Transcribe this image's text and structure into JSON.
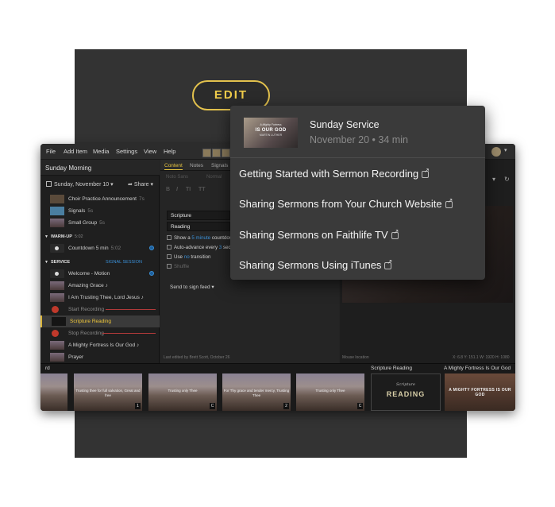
{
  "badge": {
    "label": "EDIT"
  },
  "popover": {
    "thumb": {
      "line1": "A Mighty Fortress",
      "line2": "IS OUR GOD",
      "line3": "MARTIN LUTHER"
    },
    "title": "Sunday Service",
    "date": "November 20",
    "separator": "•",
    "duration": "34 min",
    "links": [
      {
        "label": "Getting Started with Sermon Recording"
      },
      {
        "label": "Sharing Sermons from Your Church Website"
      },
      {
        "label": "Sharing Sermons on Faithlife TV"
      },
      {
        "label": "Sharing Sermons Using iTunes"
      }
    ]
  },
  "menu": [
    "File",
    "Add Item",
    "Media",
    "Settings",
    "View",
    "Help"
  ],
  "left_panel": {
    "service_title": "Sunday Morning",
    "date": "Sunday, November 10",
    "date_caret": "▾",
    "share": "Share",
    "items_top": [
      {
        "label": "Choir Practice Announcement",
        "meta": "7s"
      },
      {
        "label": "Signals",
        "meta": "5s"
      },
      {
        "label": "Small Group",
        "meta": "5s"
      }
    ],
    "sections": [
      {
        "name": "WARM-UP",
        "time": "5:02"
      },
      {
        "name": "SERVICE",
        "time": "",
        "hint": "SIGNAL SESSION"
      }
    ],
    "countdown": {
      "label": "Countdown 5 min",
      "meta": "5:02"
    },
    "service_items": [
      {
        "label": "Welcome - Motion"
      },
      {
        "label": "Amazing Grace",
        "suffix": "♪"
      },
      {
        "label": "I Am Trusting Thee, Lord Jesus",
        "suffix": "♪"
      },
      {
        "label": "Start Recording"
      },
      {
        "label": "Scripture Reading"
      },
      {
        "label": "Stop Recording"
      },
      {
        "label": "A Mighty Fortress Is Our God",
        "suffix": "♪"
      },
      {
        "label": "Prayer"
      }
    ]
  },
  "editor": {
    "tabs": [
      "Content",
      "Notes",
      "Signals"
    ],
    "tool_labels": {
      "font": "Noto Sans",
      "weight": "Normal"
    },
    "format_buttons": [
      "B",
      "I",
      "TI",
      "TT"
    ],
    "type_field": "Scripture",
    "mode_field": "Reading",
    "options": [
      {
        "pre": "Show a",
        "link": "5 minute",
        "post": "countdown"
      },
      {
        "pre": "Auto-advance every",
        "link": "3",
        "post": "sec"
      },
      {
        "pre": "Use",
        "link": "no",
        "post": "transition"
      },
      {
        "pre": "Shuffle",
        "link": "",
        "post": ""
      }
    ],
    "send_feed": "Send to sign feed",
    "edited_by": "Last edited by Brett Scott, October 26"
  },
  "preview": {
    "mouse_label": "Mouse location",
    "coords": "X: 6.8   Y: 151.1   W: 1920   H: 1080"
  },
  "strip": {
    "labels": {
      "left": "rd",
      "reading": "Scripture Reading",
      "fortress": "A Mighty Fortress Is Our God"
    },
    "slides": [
      {
        "caption": "",
        "index": ""
      },
      {
        "caption": "Trusting thee for full salvation, Great and free",
        "index": "1"
      },
      {
        "caption": "Trusting only Thee",
        "index": "C"
      },
      {
        "caption": "For Thy grace and tender mercy, Trusting Thee",
        "index": "2"
      },
      {
        "caption": "Trusting only Thee",
        "index": "C"
      }
    ],
    "reading_slide": {
      "line1": "Scripture",
      "line2": "READING"
    },
    "fortress_slide": {
      "caption": "A MIGHTY FORTRESS IS OUR GOD"
    }
  },
  "colors": {
    "accent_gold": "#e2c14d",
    "link_blue": "#3a8fd6",
    "record_red": "#c0392b"
  },
  "icons": [
    "calendar-icon",
    "share-icon",
    "external-link-icon",
    "record-icon",
    "film-icon"
  ]
}
